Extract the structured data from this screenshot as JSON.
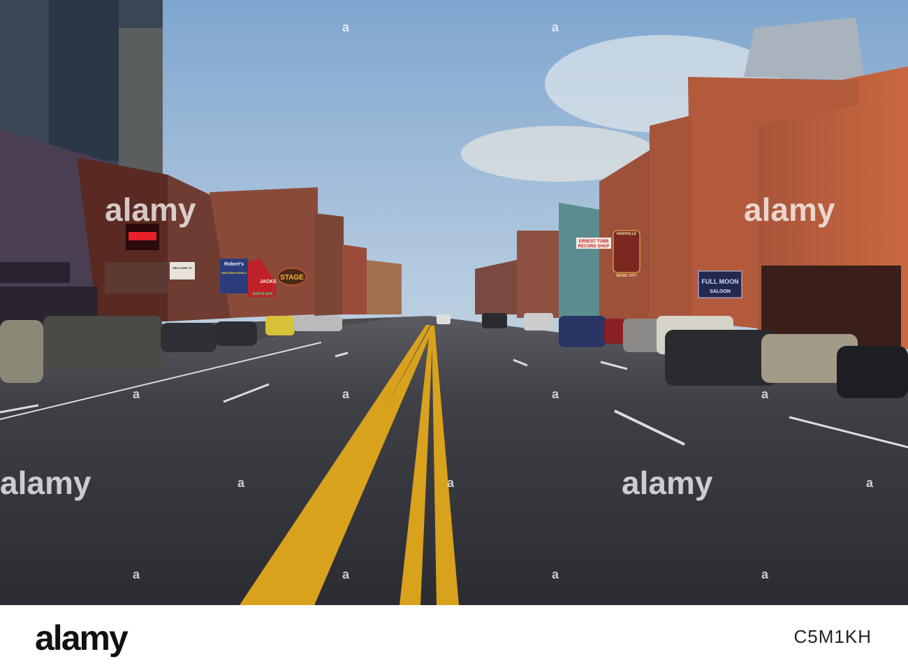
{
  "watermark": {
    "text": "alamy",
    "small_mark": "a"
  },
  "footer": {
    "logo": "alamy",
    "image_id": "C5M1KH"
  },
  "signs": {
    "ernest_tubb": "ERNEST TUBB",
    "record_shop": "RECORD SHOP",
    "full_moon": "FULL MOON",
    "saloon": "SALOON",
    "stage": "STAGE",
    "roberts": "Robert's",
    "western_world": "WESTERN WORLD",
    "jacks": "JACKS",
    "bar_b_que": "BAR-B-QUE",
    "music_city": "MUSIC CITY",
    "nashville": "NASHVILLE",
    "welcome": "WELCOME TO"
  }
}
